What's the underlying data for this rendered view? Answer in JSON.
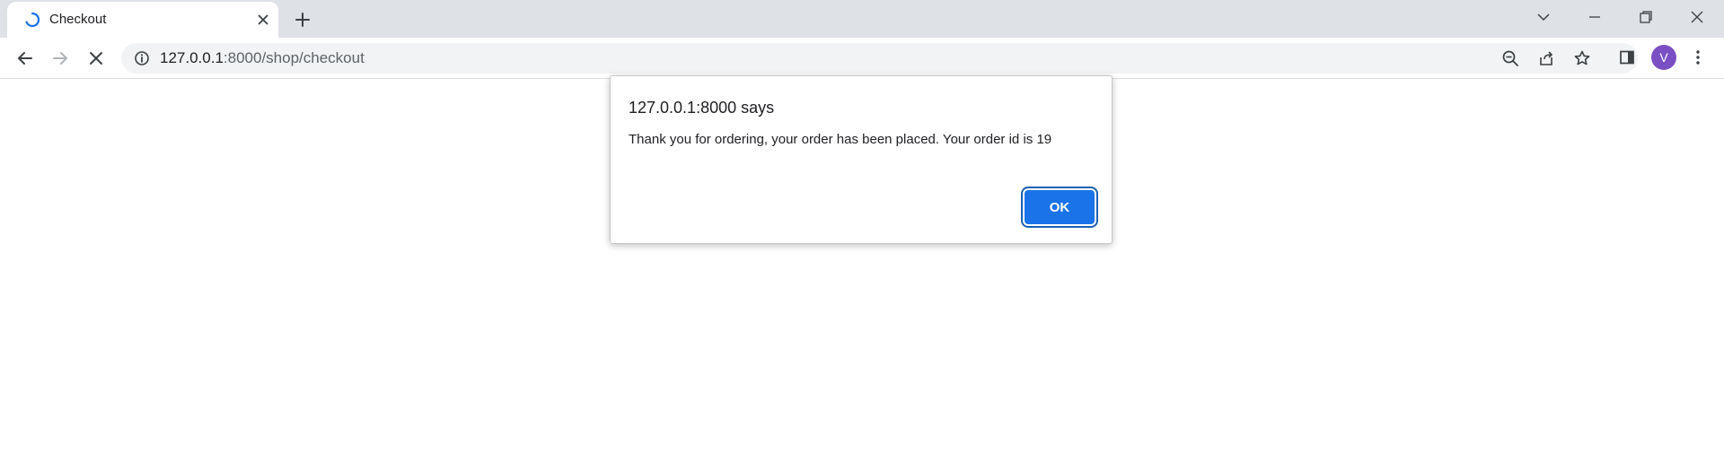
{
  "browser": {
    "tab": {
      "title": "Checkout",
      "loading_icon": "spinner-icon",
      "close_icon": "close-icon"
    },
    "new_tab_icon": "plus-icon",
    "window_controls": [
      "chevron-down-icon",
      "minimize-icon",
      "restore-icon",
      "close-icon"
    ],
    "address_bar": {
      "host": "127.0.0.1",
      "port_path": ":8000/shop/checkout",
      "security_icon": "info-icon"
    },
    "toolbar_icons": [
      "zoom-out-icon",
      "share-icon",
      "star-icon",
      "side-panel-icon",
      "more-icon"
    ],
    "profile": {
      "initial": "V",
      "color": "#7b4fc4"
    }
  },
  "dialog": {
    "title": "127.0.0.1:8000 says",
    "message": "Thank you for ordering, your order has been placed. Your order id is 19",
    "ok_label": "OK",
    "accent": "#1a73e8"
  }
}
